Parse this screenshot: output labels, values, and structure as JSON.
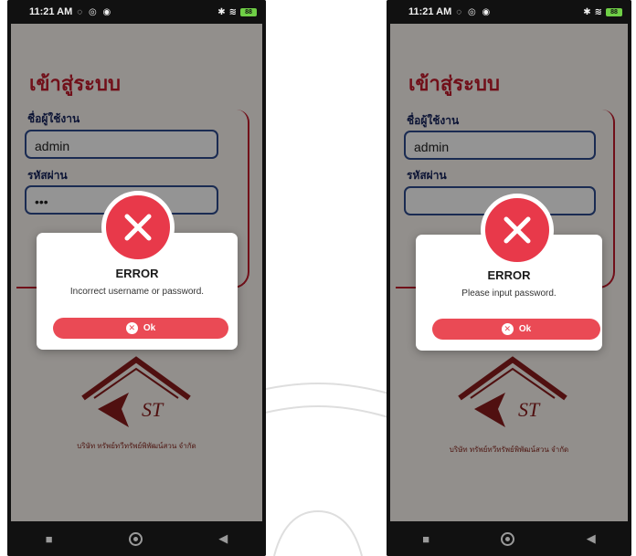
{
  "screens": [
    {
      "status": {
        "time": "11:21 AM",
        "battery": "88"
      },
      "app_title": "เข้าสู่ระบบ",
      "username_label": "ชื่อผู้ใช้งาน",
      "username_value": "admin",
      "password_label": "รหัสผ่าน",
      "password_value": "•••",
      "dialog": {
        "title": "ERROR",
        "message": "Incorrect username or password.",
        "ok_label": "Ok"
      },
      "company_name": "บริษัท ทรัพย์ทวีทรัพย์พิพัฒน์สวน จำกัด"
    },
    {
      "status": {
        "time": "11:21 AM",
        "battery": "88"
      },
      "app_title": "เข้าสู่ระบบ",
      "username_label": "ชื่อผู้ใช้งาน",
      "username_value": "admin",
      "password_label": "รหัสผ่าน",
      "password_value": "",
      "dialog": {
        "title": "ERROR",
        "message": "Please input password.",
        "ok_label": "Ok"
      },
      "company_name": "บริษัท ทรัพย์ทวีทรัพย์พิพัฒน์สวน จำกัด"
    }
  ],
  "logo": {
    "initials": "ST"
  },
  "colors": {
    "brand_red": "#c31b2c",
    "error_red": "#e8394a",
    "button_red": "#ea4a55",
    "field_border": "#2d4a8e",
    "label_navy": "#16245c"
  },
  "icons": [
    "close-icon",
    "stop-icon",
    "home-icon",
    "back-icon",
    "wifi-icon",
    "bluetooth-icon",
    "battery-icon"
  ]
}
